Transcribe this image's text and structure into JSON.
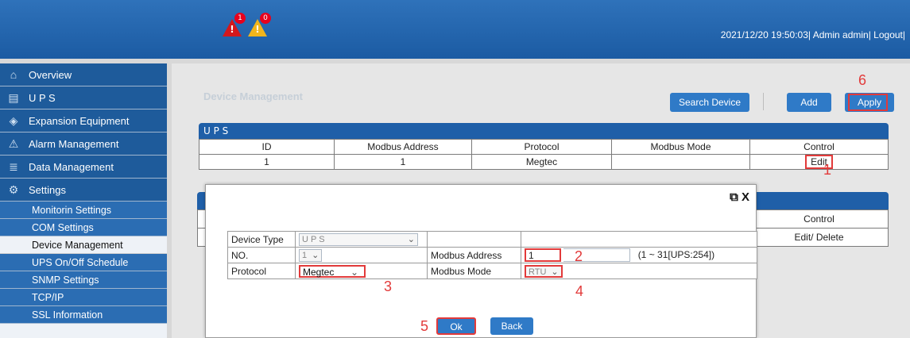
{
  "header": {
    "alarm_critical_count": "1",
    "alarm_warning_count": "0",
    "datetime": "2021/12/20 19:50:03",
    "user": "Admin admin",
    "logout": "Logout"
  },
  "sidebar": {
    "items": [
      {
        "label": "Overview",
        "icon": "home-icon"
      },
      {
        "label": "U P S",
        "icon": "battery-icon"
      },
      {
        "label": "Expansion Equipment",
        "icon": "expansion-icon"
      },
      {
        "label": "Alarm Management",
        "icon": "warning-icon"
      },
      {
        "label": "Data Management",
        "icon": "database-icon"
      },
      {
        "label": "Settings",
        "icon": "gear-icon"
      }
    ],
    "sub_items": [
      {
        "label": "Monitorin Settings"
      },
      {
        "label": "COM Settings"
      },
      {
        "label": "Device Management"
      },
      {
        "label": "UPS On/Off Schedule"
      },
      {
        "label": "SNMP Settings"
      },
      {
        "label": "TCP/IP"
      },
      {
        "label": "SSL Information"
      }
    ]
  },
  "main": {
    "title": "Device Management",
    "search_device": "Search Device",
    "add": "Add",
    "apply": "Apply",
    "ups_panel_title": "U P S",
    "columns": [
      "ID",
      "Modbus Address",
      "Protocol",
      "Modbus Mode",
      "Control"
    ],
    "rows": [
      {
        "id": "1",
        "modbus_address": "1",
        "protocol": "Megtec",
        "modbus_mode": "",
        "control": "Edit"
      }
    ],
    "panel2_control": "Control",
    "panel2_actions": "Edit/ Delete"
  },
  "modal": {
    "close_label": "X",
    "device_type_label": "Device Type",
    "device_type_value": "U P S",
    "no_label": "NO.",
    "no_value": "1",
    "modbus_address_label": "Modbus Address",
    "modbus_address_value": "1",
    "modbus_address_range": "(1 ~ 31[UPS:254])",
    "protocol_label": "Protocol",
    "protocol_value": "Megtec",
    "modbus_mode_label": "Modbus Mode",
    "modbus_mode_value": "RTU",
    "ok": "Ok",
    "back": "Back"
  },
  "annotations": {
    "n1": "1",
    "n2": "2",
    "n3": "3",
    "n4": "4",
    "n5": "5",
    "n6": "6"
  },
  "colors": {
    "header_blue": "#1b5ba3",
    "nav_blue": "#1e5b9b",
    "button_blue": "#2f7ac7",
    "annotation_red": "#e23a3a"
  }
}
